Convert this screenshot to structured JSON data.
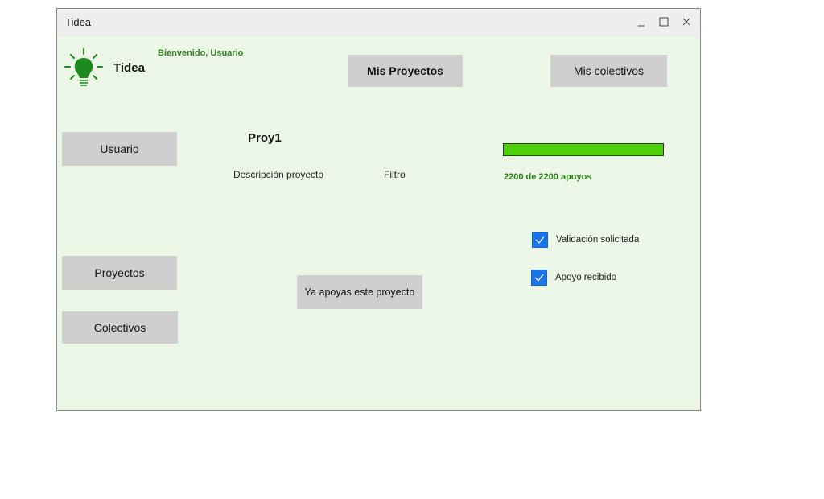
{
  "window": {
    "title": "Tidea"
  },
  "header": {
    "logo_text": "Tidea",
    "welcome": "Bienvenido, Usuario",
    "nav": {
      "mis_proyectos": "Mis Proyectos",
      "mis_colectivos": "Mis colectivos"
    }
  },
  "sidebar": {
    "usuario": "Usuario",
    "proyectos": "Proyectos",
    "colectivos": "Colectivos"
  },
  "project": {
    "name": "Proy1",
    "description": "Descripción proyecto",
    "filter": "Filtro",
    "support_button": "Ya apoyas este proyecto",
    "support_progress": 1.0,
    "support_text": "2200 de 2200 apoyos",
    "checks": [
      {
        "label": "Validación solicitada",
        "checked": true
      },
      {
        "label": "Apoyo recibido",
        "checked": true
      }
    ]
  },
  "colors": {
    "accent_green": "#2e7d1e",
    "progress_green": "#4fd10e",
    "checkbox_blue": "#1a73e8",
    "background": "#ecf6e6"
  },
  "icons": {
    "logo": "lightbulb-icon",
    "minimize": "minimize-icon",
    "maximize": "maximize-icon",
    "close": "close-icon",
    "check": "check-icon"
  }
}
